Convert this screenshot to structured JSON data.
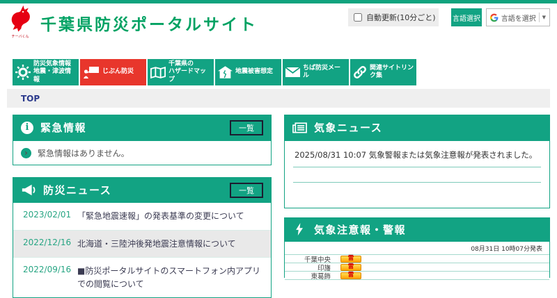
{
  "colors": {
    "brand_green": "#12a383",
    "title_green": "#00a263",
    "accent_red": "#e8362c",
    "badge_bg": "#ffaa00",
    "badge_text": "#d40000",
    "navy": "#2b3a8c"
  },
  "header": {
    "site_title": "千葉県防災ポータルサイト",
    "mascot_name": "チーバくん",
    "auto_update_label": "自動更新(10分ごと)",
    "language_select_button": "言語選択",
    "translate": {
      "g": "G",
      "label": "言語を選択",
      "arrow": "▼"
    }
  },
  "nav": {
    "items": [
      {
        "line1": "防災気象情報",
        "line2": "地震・津波情報"
      },
      {
        "line1": "じぶん防災"
      },
      {
        "line1": "千葉県の",
        "line2": "ハザードマップ"
      },
      {
        "line1": "地震被害想定"
      },
      {
        "line1": "ちば防災メール"
      },
      {
        "line1": "関連サイトリンク集"
      }
    ]
  },
  "breadcrumb": "TOP",
  "emergency": {
    "title": "緊急情報",
    "list_button": "一覧",
    "message": "緊急情報はありません。"
  },
  "news": {
    "title": "防災ニュース",
    "list_button": "一覧",
    "items": [
      {
        "date": "2023/02/01",
        "text": "「緊急地震速報」の発表基準の変更について"
      },
      {
        "date": "2022/12/16",
        "text": "北海道・三陸沖後発地震注意情報について"
      },
      {
        "date": "2022/09/16",
        "text": "■防災ポータルサイトのスマートフォン内アプリでの閲覧について"
      }
    ]
  },
  "weather_news": {
    "title": "気象ニュース",
    "items": [
      "2025/08/31 10:07 気象警報または気象注意報が発表されました。"
    ]
  },
  "warnings": {
    "title": "気象注意報・警報",
    "issued": "08月31日 10時07分発表",
    "rows": [
      {
        "region": "千葉中央",
        "badge": "雷"
      },
      {
        "region": "印旛",
        "badge": "雷"
      },
      {
        "region": "東葛飾",
        "badge": "雷"
      }
    ]
  }
}
